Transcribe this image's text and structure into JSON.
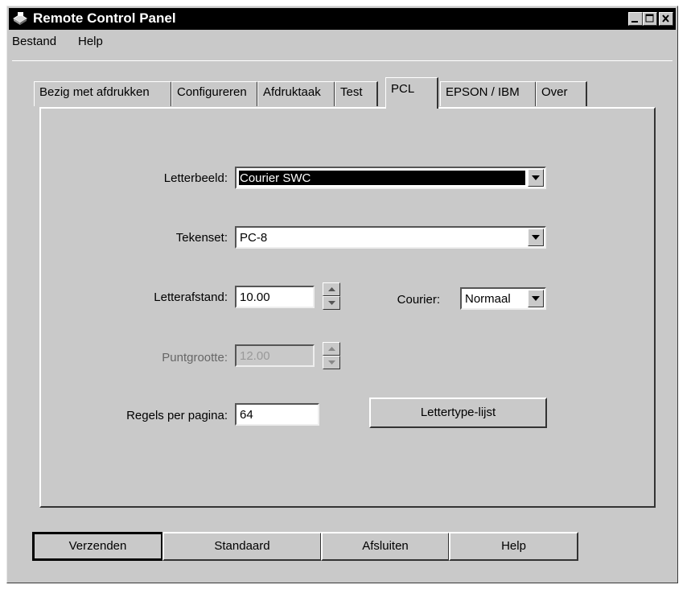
{
  "window": {
    "title": "Remote Control Panel"
  },
  "menu": {
    "items": [
      "Bestand",
      "Help"
    ]
  },
  "tabs": [
    "Bezig met afdrukken",
    "Configureren",
    "Afdruktaak",
    "Test",
    "PCL",
    "EPSON / IBM",
    "Over"
  ],
  "active_tab": "PCL",
  "pcl": {
    "letterbeeld": {
      "label": "Letterbeeld:",
      "value": "Courier SWC"
    },
    "tekenset": {
      "label": "Tekenset:",
      "value": "PC-8"
    },
    "letterafstand": {
      "label": "Letterafstand:",
      "value": "10.00"
    },
    "courier": {
      "label": "Courier:",
      "value": "Normaal"
    },
    "puntgrootte": {
      "label": "Puntgrootte:",
      "value": "12.00"
    },
    "regels": {
      "label": "Regels per pagina:",
      "value": "64"
    },
    "lettertype_button": "Lettertype-lijst"
  },
  "buttons": {
    "send": "Verzenden",
    "default": "Standaard",
    "close": "Afsluiten",
    "help": "Help"
  }
}
